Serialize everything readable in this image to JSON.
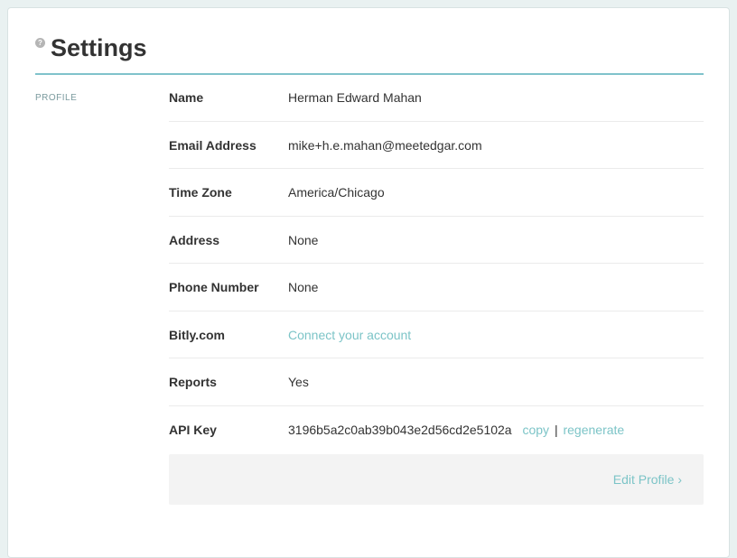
{
  "header": {
    "title": "Settings",
    "help_glyph": "?"
  },
  "section": {
    "label": "PROFILE"
  },
  "profile": {
    "rows": [
      {
        "label": "Name",
        "value": "Herman Edward Mahan"
      },
      {
        "label": "Email Address",
        "value": "mike+h.e.mahan@meetedgar.com"
      },
      {
        "label": "Time Zone",
        "value": "America/Chicago"
      },
      {
        "label": "Address",
        "value": "None"
      },
      {
        "label": "Phone Number",
        "value": "None"
      },
      {
        "label": "Bitly.com",
        "link": "Connect your account"
      },
      {
        "label": "Reports",
        "value": "Yes"
      },
      {
        "label": "API Key",
        "value": "3196b5a2c0ab39b043e2d56cd2e5102a",
        "copy": "copy",
        "separator": "|",
        "regenerate": "regenerate"
      }
    ]
  },
  "footer": {
    "edit_label": "Edit Profile ›"
  },
  "colors": {
    "accent": "#7cc4c7",
    "divider": "#80c3cb",
    "background": "#e9f1f1"
  }
}
